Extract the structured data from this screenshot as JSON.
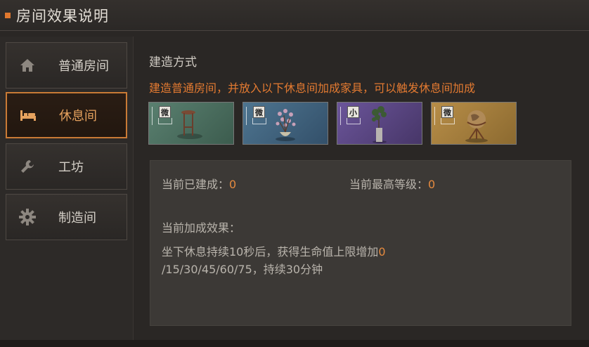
{
  "window": {
    "title": "房间效果说明"
  },
  "sidebar": {
    "items": [
      {
        "label": "普通房间",
        "icon": "home-icon",
        "active": false
      },
      {
        "label": "休息间",
        "icon": "bed-icon",
        "active": true
      },
      {
        "label": "工坊",
        "icon": "wrench-icon",
        "active": false
      },
      {
        "label": "制造间",
        "icon": "gear-icon",
        "active": false
      }
    ]
  },
  "main": {
    "section_title": "建造方式",
    "notice": "建造普通房间，并放入以下休息间加成家具，可以触发休息间加成",
    "furniture": [
      {
        "size_tag": "微",
        "icon": "side-table-icon",
        "color": "#4a6e5e"
      },
      {
        "size_tag": "微",
        "icon": "flower-vase-icon",
        "color": "#3f6078"
      },
      {
        "size_tag": "小",
        "icon": "potted-plant-icon",
        "color": "#5a4680"
      },
      {
        "size_tag": "微",
        "icon": "globe-icon",
        "color": "#a07c3c"
      }
    ],
    "built_label": "当前已建成：",
    "built_value": "0",
    "max_level_label": "当前最高等级：",
    "max_level_value": "0",
    "effect_label": "当前加成效果：",
    "effect_line1_text": "坐下休息持续10秒后，获得生命值上限增加",
    "effect_line1_value": "0",
    "effect_line2": "/15/30/45/60/75，持续30分钟"
  },
  "colors": {
    "accent": "#e37a31",
    "active_border": "#c97a35",
    "panel": "#3c3936"
  }
}
